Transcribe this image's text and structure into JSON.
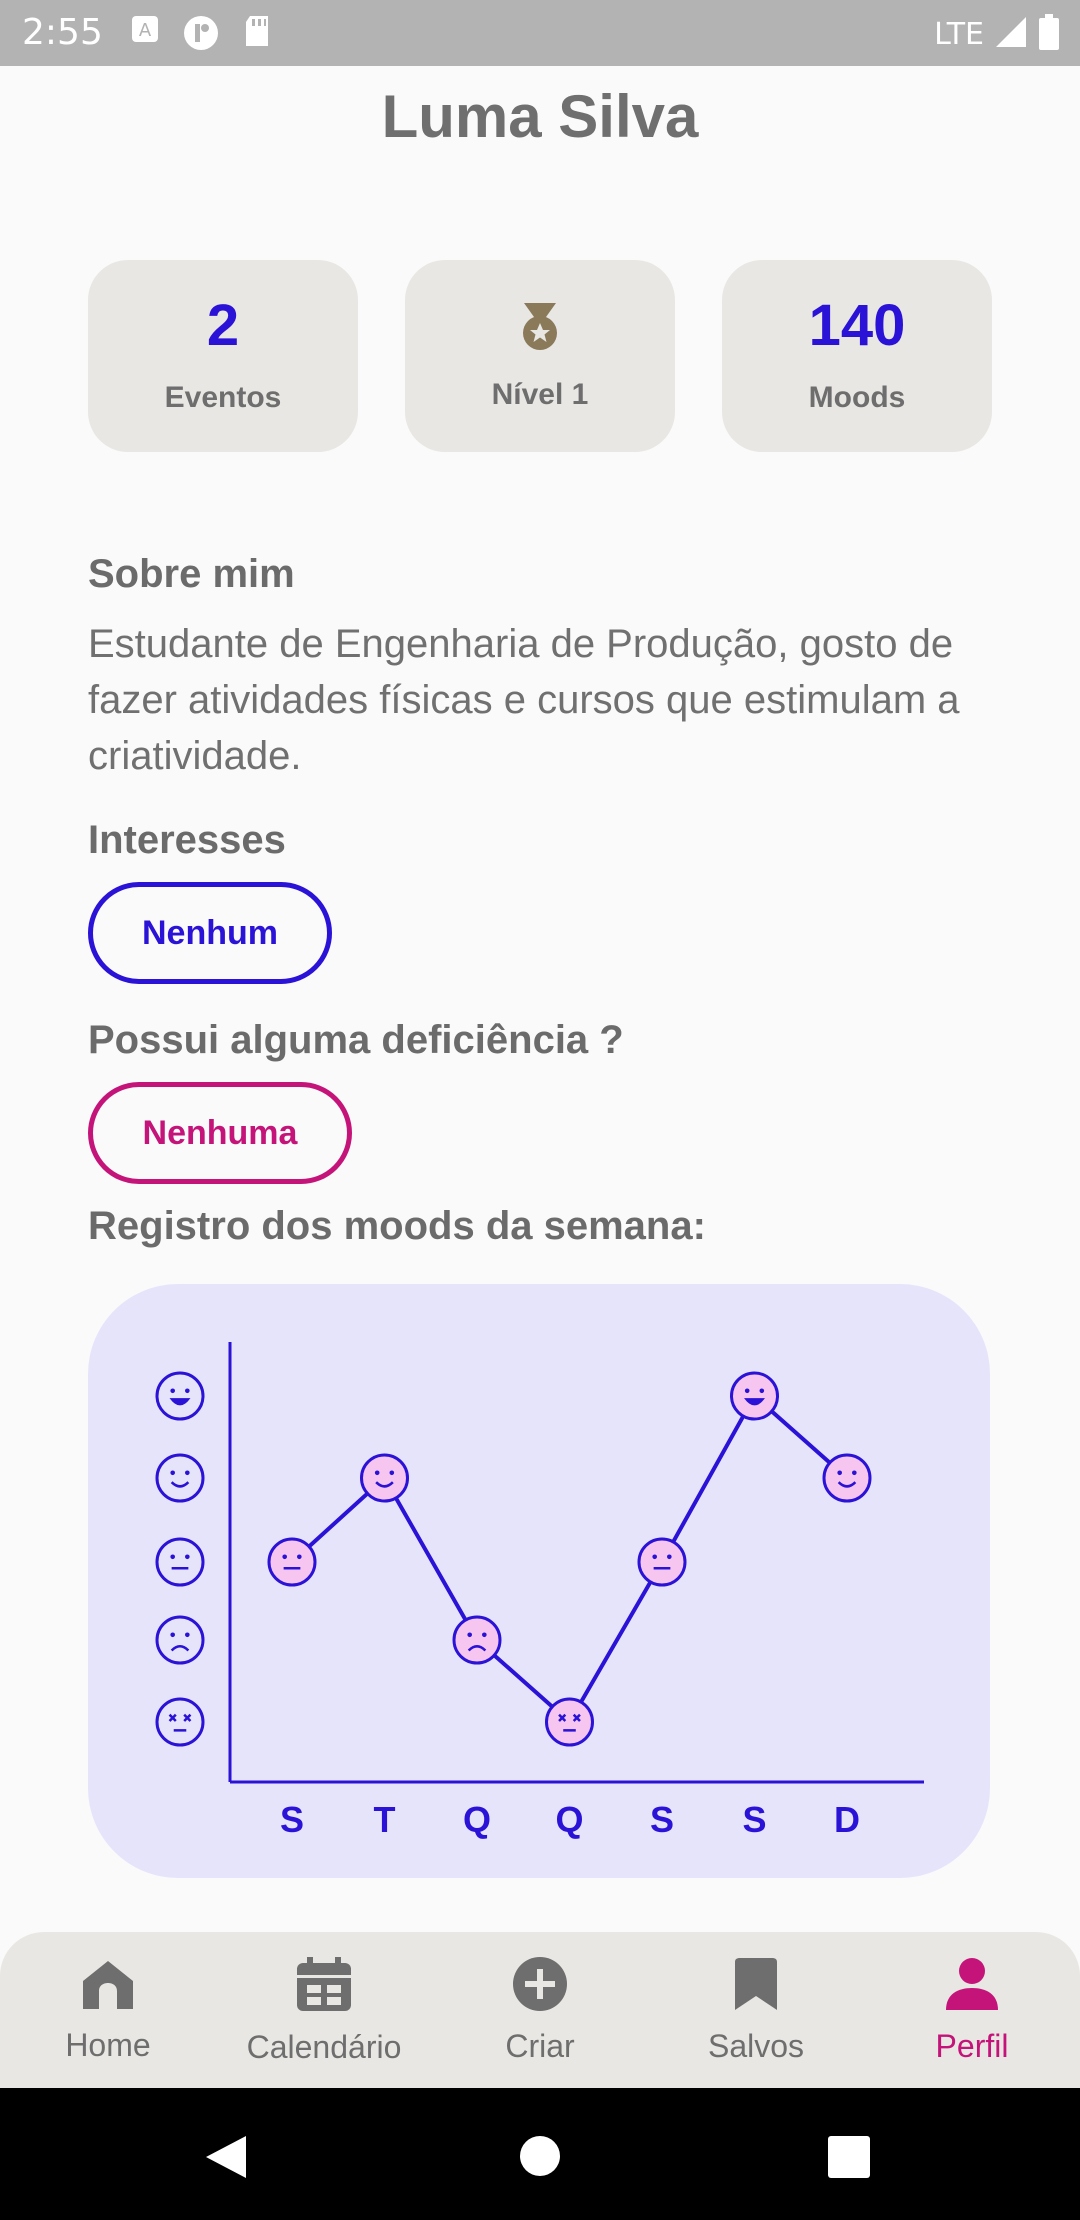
{
  "status_bar": {
    "time": "2:55",
    "network": "LTE"
  },
  "profile": {
    "name": "Luma Silva"
  },
  "stats": [
    {
      "value": "2",
      "label": "Eventos"
    },
    {
      "icon": "medal-icon",
      "label": "Nível 1"
    },
    {
      "value": "140",
      "label": "Moods"
    }
  ],
  "about": {
    "heading": "Sobre mim",
    "text": "Estudante de Engenharia de Produção, gosto de fazer atividades físicas e cursos que estimulam a criatividade."
  },
  "interests": {
    "heading": "Interesses",
    "chip": "Nenhum"
  },
  "disability": {
    "heading": "Possui alguma deficiência ?",
    "chip": "Nenhuma"
  },
  "moods_heading": "Registro dos moods da semana:",
  "chart_data": {
    "type": "line",
    "categories": [
      "S",
      "T",
      "Q",
      "Q",
      "S",
      "S",
      "D"
    ],
    "values": [
      3,
      4,
      2,
      1,
      3,
      5,
      4
    ],
    "y_scale": [
      "very-sad",
      "sad",
      "neutral",
      "happy",
      "very-happy"
    ],
    "ylim": [
      1,
      5
    ],
    "line_color": "#2a12d6",
    "marker_fill": "#f7c6f0"
  },
  "nav": {
    "items": [
      {
        "label": "Home",
        "icon": "home-icon"
      },
      {
        "label": "Calendário",
        "icon": "calendar-icon"
      },
      {
        "label": "Criar",
        "icon": "add-circle-icon"
      },
      {
        "label": "Salvos",
        "icon": "bookmark-icon"
      },
      {
        "label": "Perfil",
        "icon": "person-icon",
        "active": true
      }
    ]
  },
  "colors": {
    "accent_blue": "#2a12d6",
    "accent_pink": "#c4147a",
    "card_bg": "#e8e7e3",
    "chart_bg": "#e6e4fb"
  }
}
